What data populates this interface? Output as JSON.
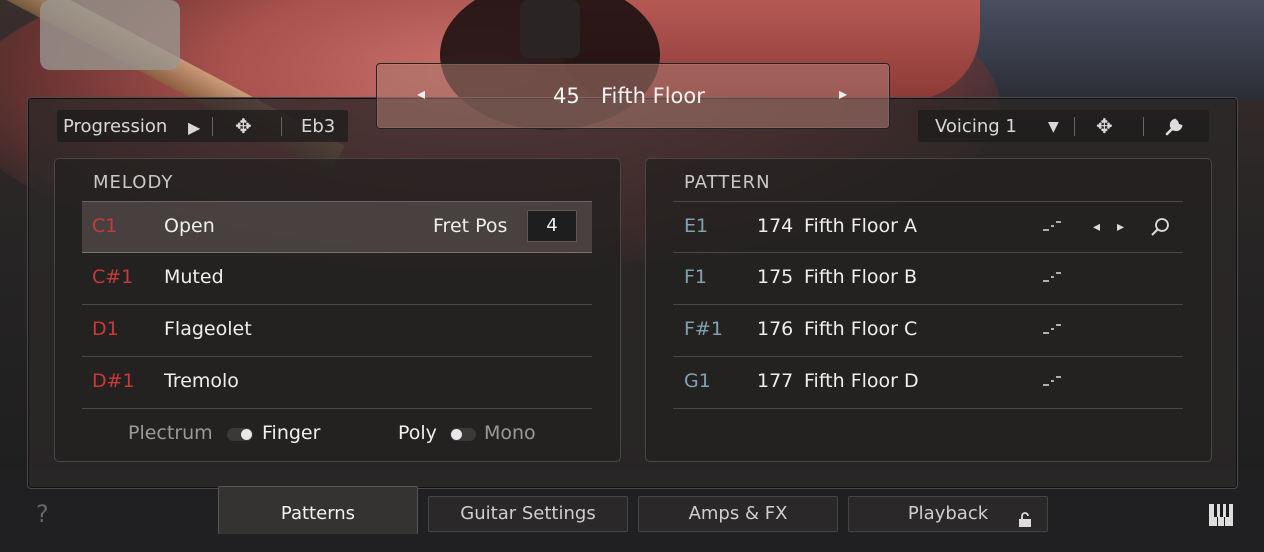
{
  "nav": {
    "prev": "◂",
    "next": "▸",
    "number": "45",
    "title": "Fifth Floor"
  },
  "toolbar_left": {
    "progression": "Progression",
    "play": "▶",
    "move": "✥",
    "key": "Eb3"
  },
  "toolbar_right": {
    "voicing": "Voicing 1",
    "dropdown": "▼",
    "move": "✥",
    "settings": "🔧"
  },
  "melody": {
    "header": "MELODY",
    "rows": [
      {
        "key": "C1",
        "label": "Open"
      },
      {
        "key": "C#1",
        "label": "Muted"
      },
      {
        "key": "D1",
        "label": "Flageolet"
      },
      {
        "key": "D#1",
        "label": "Tremolo"
      }
    ],
    "fret_label": "Fret Pos",
    "fret_value": "4",
    "toggle1": {
      "left": "Plectrum",
      "right": "Finger"
    },
    "toggle2": {
      "left": "Poly",
      "right": "Mono"
    }
  },
  "pattern": {
    "header": "PATTERN",
    "rows": [
      {
        "key": "E1",
        "num": "174",
        "name": "Fifth Floor A"
      },
      {
        "key": "F1",
        "num": "175",
        "name": "Fifth Floor B"
      },
      {
        "key": "F#1",
        "num": "176",
        "name": "Fifth Floor C"
      },
      {
        "key": "G1",
        "num": "177",
        "name": "Fifth Floor D"
      }
    ]
  },
  "tabs": {
    "patterns": "Patterns",
    "guitar": "Guitar Settings",
    "amps": "Amps & FX",
    "playback": "Playback"
  },
  "help": "?",
  "icons": {
    "pattern": "pattern-curve-icon",
    "search": "search-icon",
    "lock": "lock-icon",
    "keyboard": "keyboard-icon"
  }
}
